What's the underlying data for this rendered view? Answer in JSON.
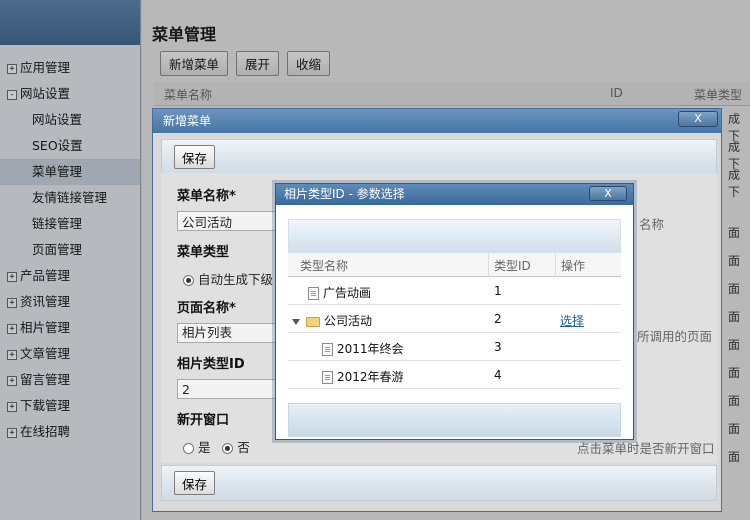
{
  "sidebar": {
    "items": [
      {
        "label": "应用管理",
        "toggle": "+",
        "level": 0
      },
      {
        "label": "网站设置",
        "toggle": "-",
        "level": 0
      },
      {
        "label": "网站设置",
        "level": 1
      },
      {
        "label": "SEO设置",
        "level": 1
      },
      {
        "label": "菜单管理",
        "level": 1,
        "active": true
      },
      {
        "label": "友情链接管理",
        "level": 1
      },
      {
        "label": "链接管理",
        "level": 1
      },
      {
        "label": "页面管理",
        "level": 1
      },
      {
        "label": "产品管理",
        "toggle": "+",
        "level": 0
      },
      {
        "label": "资讯管理",
        "toggle": "+",
        "level": 0
      },
      {
        "label": "相片管理",
        "toggle": "+",
        "level": 0
      },
      {
        "label": "文章管理",
        "toggle": "+",
        "level": 0
      },
      {
        "label": "留言管理",
        "toggle": "+",
        "level": 0
      },
      {
        "label": "下载管理",
        "toggle": "+",
        "level": 0
      },
      {
        "label": "在线招聘",
        "toggle": "+",
        "level": 0
      }
    ]
  },
  "main": {
    "title": "菜单管理",
    "toolbar": {
      "add_label": "新增菜单",
      "expand_label": "展开",
      "collapse_label": "收缩"
    },
    "table": {
      "col_name": "菜单名称",
      "col_id": "ID",
      "col_type": "菜单类型"
    },
    "bg_cells": [
      "成下",
      "成下",
      "成下",
      "面",
      "面",
      "面",
      "面",
      "面",
      "面",
      "面",
      "面",
      "面"
    ]
  },
  "modal1": {
    "title": "新增菜单",
    "close_label": "X",
    "save_label": "保存",
    "fields": {
      "menu_name_label": "菜单名称*",
      "menu_name_value": "公司活动",
      "menu_type_label": "菜单类型",
      "menu_type_option": "自动生成下级",
      "page_name_label": "页面名称*",
      "page_name_value": "相片列表",
      "photo_type_label": "相片类型ID",
      "photo_type_value": "2",
      "new_window_label": "新开窗口",
      "yes_label": "是",
      "no_label": "否"
    },
    "hints": {
      "menu_name_hint": "名称",
      "page_hint": "所调用的页面",
      "window_hint": "点击菜单时是否新开窗口"
    }
  },
  "modal2": {
    "title": "相片类型ID - 参数选择",
    "close_label": "X",
    "grid": {
      "col_name": "类型名称",
      "col_id": "类型ID",
      "col_action": "操作",
      "rows": [
        {
          "name": "广告动画",
          "id": "1",
          "indent": 1,
          "icon": "doc-icon"
        },
        {
          "name": "公司活动",
          "id": "2",
          "indent": 0,
          "icon": "folder-icon",
          "action": "选择"
        },
        {
          "name": "2011年终会",
          "id": "3",
          "indent": 2,
          "icon": "doc-icon"
        },
        {
          "name": "2012年春游",
          "id": "4",
          "indent": 2,
          "icon": "doc-icon"
        }
      ]
    }
  }
}
